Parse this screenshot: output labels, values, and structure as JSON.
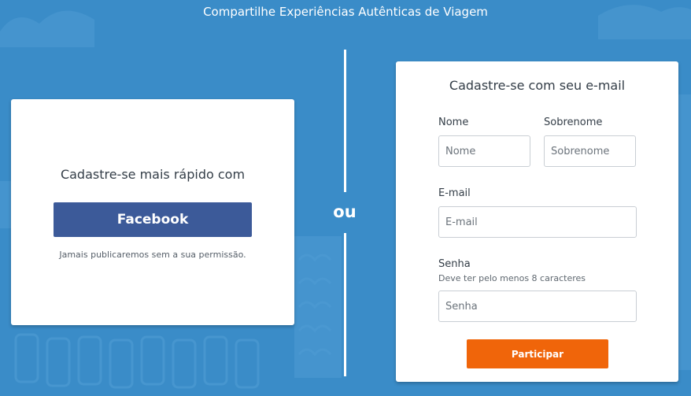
{
  "header": {
    "title": "Compartilhe Experiências Autênticas de Viagem"
  },
  "social_signup": {
    "heading": "Cadastre-se mais rápido com",
    "facebook_button": "Facebook",
    "note": "Jamais publicaremos sem a sua permissão.",
    "button_color": "#3c5a99"
  },
  "divider": {
    "label": "ou"
  },
  "email_signup": {
    "heading": "Cadastre-se com seu e-mail",
    "first_name": {
      "label": "Nome",
      "placeholder": "Nome",
      "value": ""
    },
    "last_name": {
      "label": "Sobrenome",
      "placeholder": "Sobrenome",
      "value": ""
    },
    "email": {
      "label": "E-mail",
      "placeholder": "E-mail",
      "value": ""
    },
    "password": {
      "label": "Senha",
      "hint": "Deve ter pelo menos 8 caracteres",
      "placeholder": "Senha",
      "value": ""
    },
    "submit_button": "Participar",
    "button_color": "#f0650a"
  },
  "background": {
    "color": "#3a8cc8"
  }
}
